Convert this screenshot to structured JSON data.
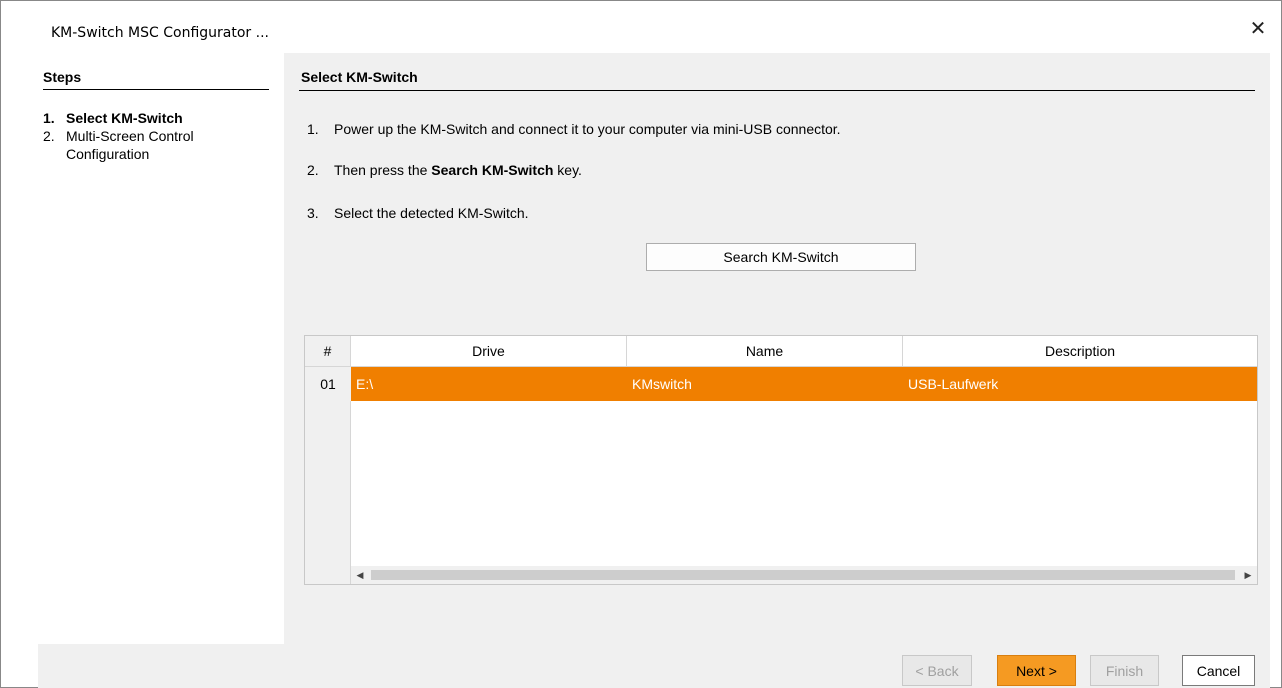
{
  "window": {
    "title": "KM-Switch MSC Configurator ...",
    "close_glyph": "✕"
  },
  "steps": {
    "title": "Steps",
    "items": [
      {
        "num": "1.",
        "label": "Select KM-Switch"
      },
      {
        "num": "2.",
        "label": "Multi-Screen Control Configuration"
      }
    ]
  },
  "main": {
    "title": "Select KM-Switch",
    "instructions": [
      {
        "num": "1.",
        "text": "Power up the KM-Switch and connect it to your computer via mini-USB connector."
      },
      {
        "num": "2.",
        "pre": "Then press the ",
        "bold": "Search KM-Switch",
        "post": " key."
      },
      {
        "num": "3.",
        "text": "Select the detected KM-Switch."
      }
    ],
    "search_button": "Search KM-Switch"
  },
  "table": {
    "columns": [
      "#",
      "Drive",
      "Name",
      "Description"
    ],
    "rows": [
      {
        "num": "01",
        "drive": "E:\\",
        "name": "KMswitch",
        "description": "USB-Laufwerk"
      }
    ],
    "selected_row_color": "#f07f00"
  },
  "buttons": {
    "back": "< Back",
    "next": "Next >",
    "finish": "Finish",
    "cancel": "Cancel"
  },
  "colors": {
    "accent": "#f59a22",
    "selection": "#f07f00"
  }
}
